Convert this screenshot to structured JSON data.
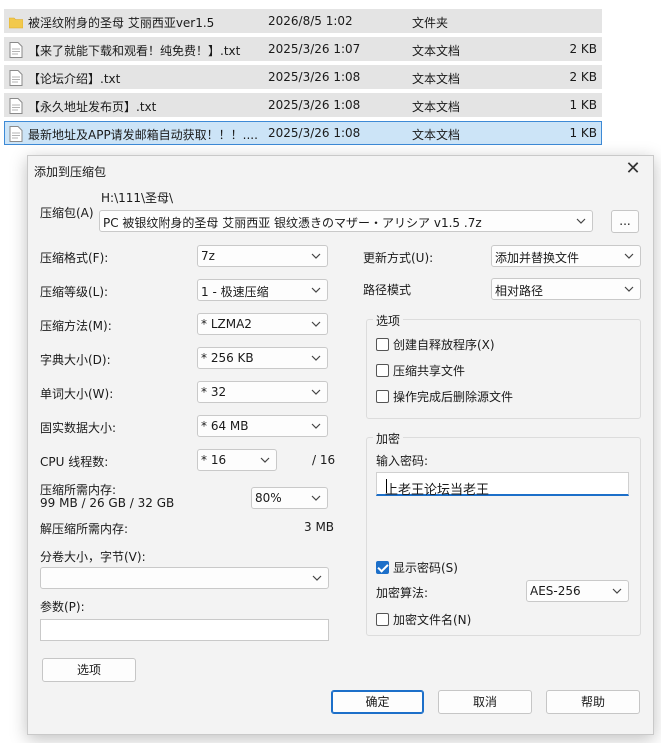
{
  "files": [
    {
      "icon": "folder-icon",
      "name": "被淫纹附身的圣母 艾丽西亚ver1.5",
      "date": "2026/8/5 1:02",
      "type": "文件夹",
      "size": ""
    },
    {
      "icon": "text-file-icon",
      "name": "【来了就能下载和观看！纯免费！】.txt",
      "date": "2025/3/26 1:07",
      "type": "文本文档",
      "size": "2 KB"
    },
    {
      "icon": "text-file-icon",
      "name": "【论坛介绍】.txt",
      "date": "2025/3/26 1:08",
      "type": "文本文档",
      "size": "2 KB"
    },
    {
      "icon": "text-file-icon",
      "name": "【永久地址发布页】.txt",
      "date": "2025/3/26 1:08",
      "type": "文本文档",
      "size": "1 KB"
    },
    {
      "icon": "text-file-icon",
      "name": "最新地址及APP请发邮箱自动获取！！！....",
      "date": "2025/3/26 1:08",
      "type": "文本文档",
      "size": "1 KB",
      "selected": true
    }
  ],
  "dialog": {
    "title": "添加到压缩包",
    "close": "✕",
    "archive": {
      "label": "压缩包(A)",
      "path": "H:\\111\\圣母\\",
      "filename": "PC 被银纹附身的圣母 艾丽西亚 银纹憑きのマザー・アリシア v1.5 .7z",
      "browse": "..."
    },
    "format": {
      "label": "压缩格式(F):",
      "value": "7z"
    },
    "level": {
      "label": "压缩等级(L):",
      "value": "1 - 极速压缩"
    },
    "method": {
      "label": "压缩方法(M):",
      "value": "* LZMA2"
    },
    "dict": {
      "label": "字典大小(D):",
      "value": "* 256 KB"
    },
    "word": {
      "label": "单词大小(W):",
      "value": "* 32"
    },
    "solid": {
      "label": "固实数据大小:",
      "value": "* 64 MB"
    },
    "threads": {
      "label": "CPU 线程数:",
      "value": "* 16",
      "max": "/ 16"
    },
    "mem_compress": {
      "label": "压缩所需内存:",
      "detail": "99 MB / 26 GB / 32 GB",
      "percent": "80%"
    },
    "mem_decompress": {
      "label": "解压缩所需内存:",
      "value": "3 MB"
    },
    "volume": {
      "label": "分卷大小，字节(V):",
      "value": ""
    },
    "params": {
      "label": "参数(P):",
      "value": ""
    },
    "options_button": "选项",
    "update": {
      "label": "更新方式(U):",
      "value": "添加并替换文件"
    },
    "pathmode": {
      "label": "路径模式",
      "value": "相对路径"
    },
    "options_group": {
      "title": "选项",
      "sfx": {
        "label": "创建自释放程序(X)",
        "checked": false
      },
      "shared": {
        "label": "压缩共享文件",
        "checked": false
      },
      "delete": {
        "label": "操作完成后删除源文件",
        "checked": false
      }
    },
    "encryption": {
      "title": "加密",
      "password_label": "输入密码:",
      "password_value": "上老王论坛当老王",
      "show_password": {
        "label": "显示密码(S)",
        "checked": true
      },
      "method_label": "加密算法:",
      "method_value": "AES-256",
      "encrypt_names": {
        "label": "加密文件名(N)",
        "checked": false
      }
    },
    "buttons": {
      "ok": "确定",
      "cancel": "取消",
      "help": "帮助"
    }
  }
}
